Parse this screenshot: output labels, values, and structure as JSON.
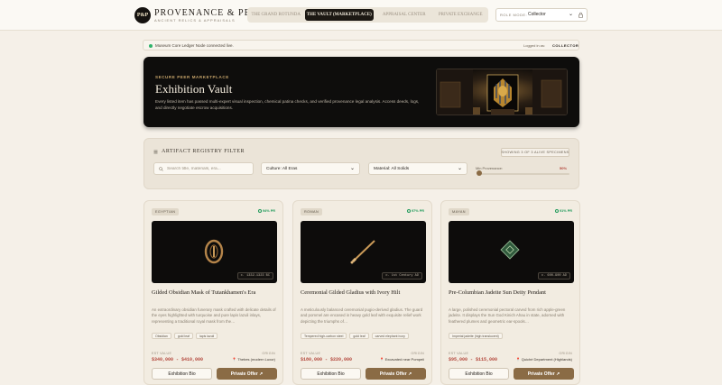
{
  "brand": {
    "logo_text": "P&P",
    "title": "PROVENANCE & PEERS",
    "subtitle": "ANCIENT RELICS & APPRAISALS"
  },
  "nav": {
    "tabs": [
      {
        "label": "THE GRAND ROTUNDA",
        "active": false
      },
      {
        "label": "THE VAULT (MARKETPLACE)",
        "active": true
      },
      {
        "label": "APPRAISAL CENTER",
        "active": false
      },
      {
        "label": "PRIVATE EXCHANGE",
        "active": false
      }
    ]
  },
  "role": {
    "label": "ROLE MODE:",
    "value": "Collector"
  },
  "status": {
    "message": "Museum Core Ledger Node connected live.",
    "logged_label": "Logged in as:",
    "role": "COLLECTOR",
    "indicator_color": "#2fb36b"
  },
  "hero": {
    "eyebrow": "SECURE PEER MARKETPLACE",
    "title": "Exhibition Vault",
    "description": "Every listed item has passed multi-expert visual inspection, chemical patina checks, and verified provenance legal analysis. Access deeds, logs, and directly negotiate escrow acquisitions."
  },
  "filter": {
    "title": "ARTIFACT REGISTRY FILTER",
    "showing": "SHOWING 3 OF 3 ALIVE SPECIMENS",
    "search_placeholder": "Search title, materials, era...",
    "culture_value": "Culture: All Eras",
    "material_value": "Material: All Solids",
    "provenance_label": "Min Provenance:",
    "provenance_value": "50%",
    "provenance_level": 0.02
  },
  "cards": [
    {
      "origin_tag": "EGYPTIAN",
      "match": "94% PR",
      "date": "c. 1332-1323 BC",
      "title": "Gilded Obsidian Mask of Tutankhamen's Era",
      "description": "An extraordinary obsidian funerary mask crafted with delicate details of the eyes highlighted with turquoise and pure lapis lazuli inlays, representing a traditional royal mask from the…",
      "tags": [
        "Obsidian",
        "gold leaf",
        "lapis lazuli"
      ],
      "est_label": "EST VALUE",
      "est_value": "$340,000 - $410,000",
      "origin_label": "ORIGIN",
      "origin_value": "Thebes (modern Luxor)",
      "bio_label": "Exhibition Bio",
      "offer_label": "Private Offer ↗",
      "icon": "ring-amulet-icon"
    },
    {
      "origin_tag": "ROMAN",
      "match": "97% PR",
      "date": "c. 1st Century AD",
      "title": "Ceremonial Gilded Gladius with Ivory Hilt",
      "description": "A meticulously balanced ceremonial pugio-derived gladius. The guard and pommel are encased in heavy gold leaf with exquisite relief work depicting the triumphs of…",
      "tags": [
        "Tempered high-carbon steel",
        "gold leaf",
        "carved elephant ivory"
      ],
      "est_label": "EST VALUE",
      "est_value": "$180,000 - $220,000",
      "origin_label": "ORIGIN",
      "origin_value": "Excavated near Pompeii",
      "bio_label": "Exhibition Bio",
      "offer_label": "Private Offer ↗",
      "icon": "sword-icon"
    },
    {
      "origin_tag": "MAYAN",
      "match": "91% PR",
      "date": "c. 600-900 AD",
      "title": "Pre-Columbian Jadeite Sun Deity Pendant",
      "description": "A large, polished ceremonial pectoral carved from rich apple-green jadeite. It displays the Sun God Kinich Ahau in state, adorned with feathered plumes and geometric ear-spools…",
      "tags": [
        "Imperial jadeite (high translucent)"
      ],
      "est_label": "EST VALUE",
      "est_value": "$95,000 - $115,000",
      "origin_label": "ORIGIN",
      "origin_value": "Quiché Department (Highlands)",
      "bio_label": "Exhibition Bio",
      "offer_label": "Private Offer ↗",
      "icon": "jade-pendant-icon"
    }
  ]
}
